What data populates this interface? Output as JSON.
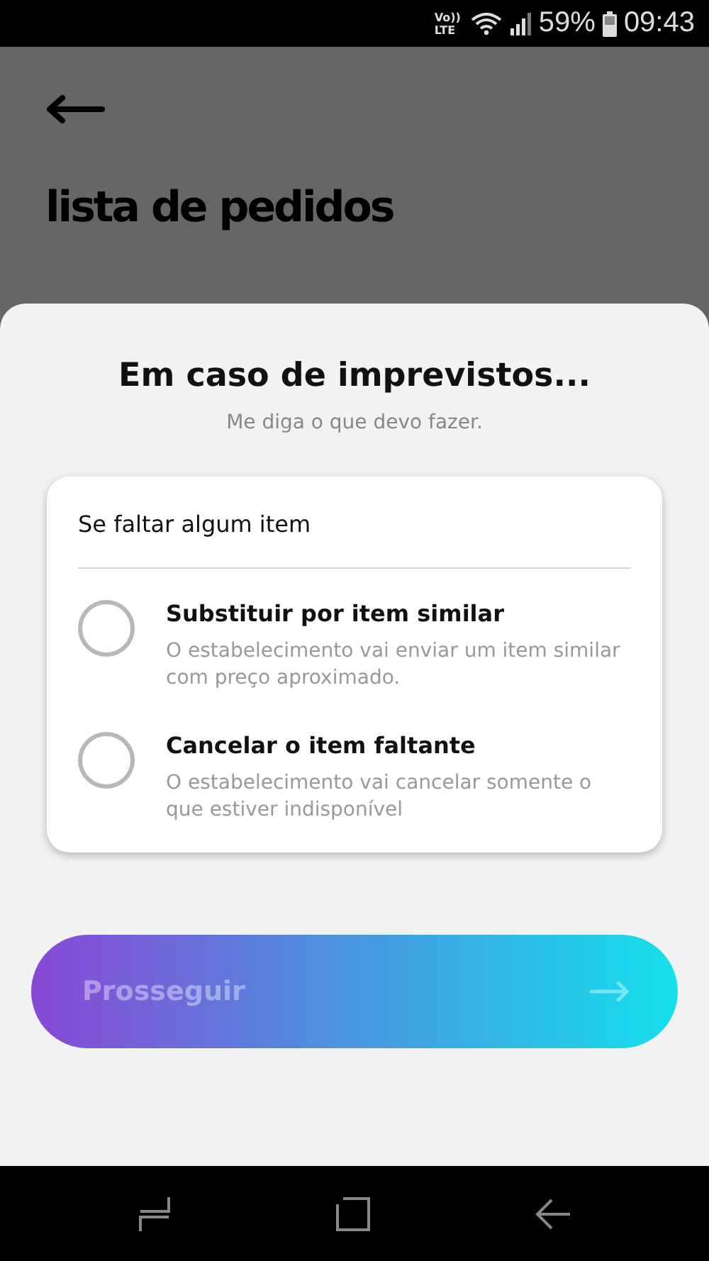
{
  "status_bar": {
    "network_top": "Vo))",
    "network_bottom": "LTE",
    "battery": "59%",
    "time": "09:43"
  },
  "header": {
    "title": "lista de pedidos"
  },
  "sheet": {
    "title": "Em caso de imprevistos...",
    "subtitle": "Me diga o que devo fazer.",
    "card": {
      "heading": "Se faltar algum item",
      "options": [
        {
          "label": "Substituir por item similar",
          "description": "O estabelecimento vai enviar um item similar com preço aproximado.",
          "selected": false
        },
        {
          "label": "Cancelar o item faltante",
          "description": "O estabelecimento vai cancelar somente o que estiver indisponível",
          "selected": false
        }
      ]
    },
    "button": {
      "label": "Prosseguir",
      "disabled": true
    }
  }
}
